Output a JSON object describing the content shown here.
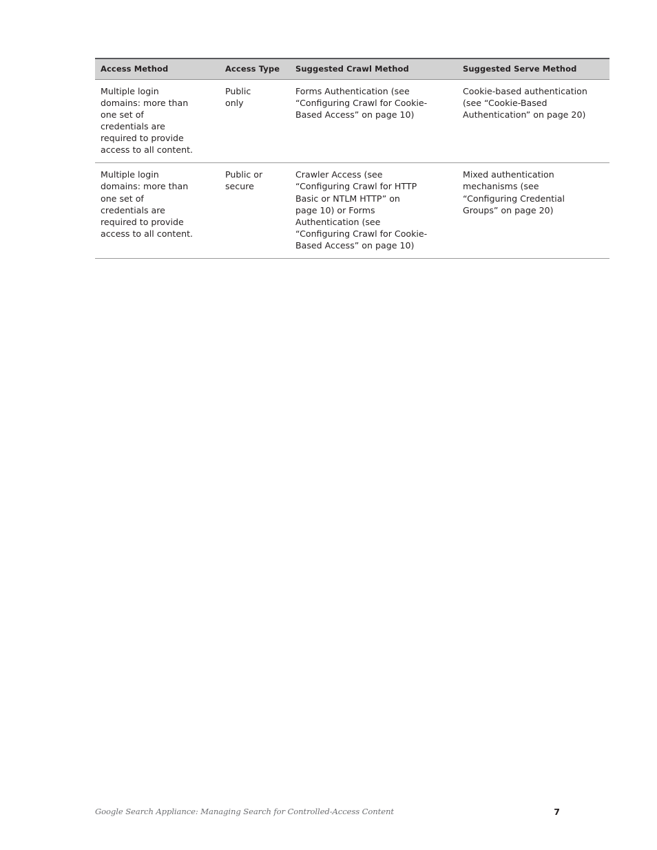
{
  "document": {
    "page_number": "7",
    "footer_title": "Google Search Appliance: Managing Search for Controlled-Access Content"
  },
  "table": {
    "headers": [
      "Access Method",
      "Access Type",
      "Suggested Crawl Method",
      "Suggested Serve Method"
    ],
    "rows": [
      {
        "access_method": [
          "Multiple login",
          "domains: more than",
          "one set of",
          "credentials are",
          "required to provide",
          "access to all content."
        ],
        "access_type": [
          "Public",
          "only"
        ],
        "suggested_crawl_method": [
          "Forms Authentication (see",
          "“Configuring Crawl for Cookie-",
          "Based Access” on page 10)"
        ],
        "suggested_serve_method": [
          "Cookie-based authentication",
          "(see “Cookie-Based",
          "Authentication” on page 20)"
        ]
      },
      {
        "access_method": [
          "Multiple login",
          "domains: more than",
          "one set of",
          "credentials are",
          "required to provide",
          "access to all content."
        ],
        "access_type": [
          "Public or",
          "secure"
        ],
        "suggested_crawl_method": [
          "Crawler Access (see",
          "“Configuring Crawl for HTTP",
          "Basic or NTLM HTTP” on",
          "page 10) or Forms",
          "Authentication (see",
          "“Configuring Crawl for Cookie-",
          "Based Access” on page 10)"
        ],
        "suggested_serve_method": [
          "Mixed authentication",
          "mechanisms (see",
          "“Configuring Credential",
          "Groups” on page 20)"
        ]
      }
    ]
  },
  "colors": {
    "header_background": "#d2d2d2",
    "header_top_rule": "#58595b",
    "row_rule": "#9a9a9a",
    "text": "#231f20",
    "footer_text": "#6d6e71",
    "page_background": "#ffffff"
  }
}
